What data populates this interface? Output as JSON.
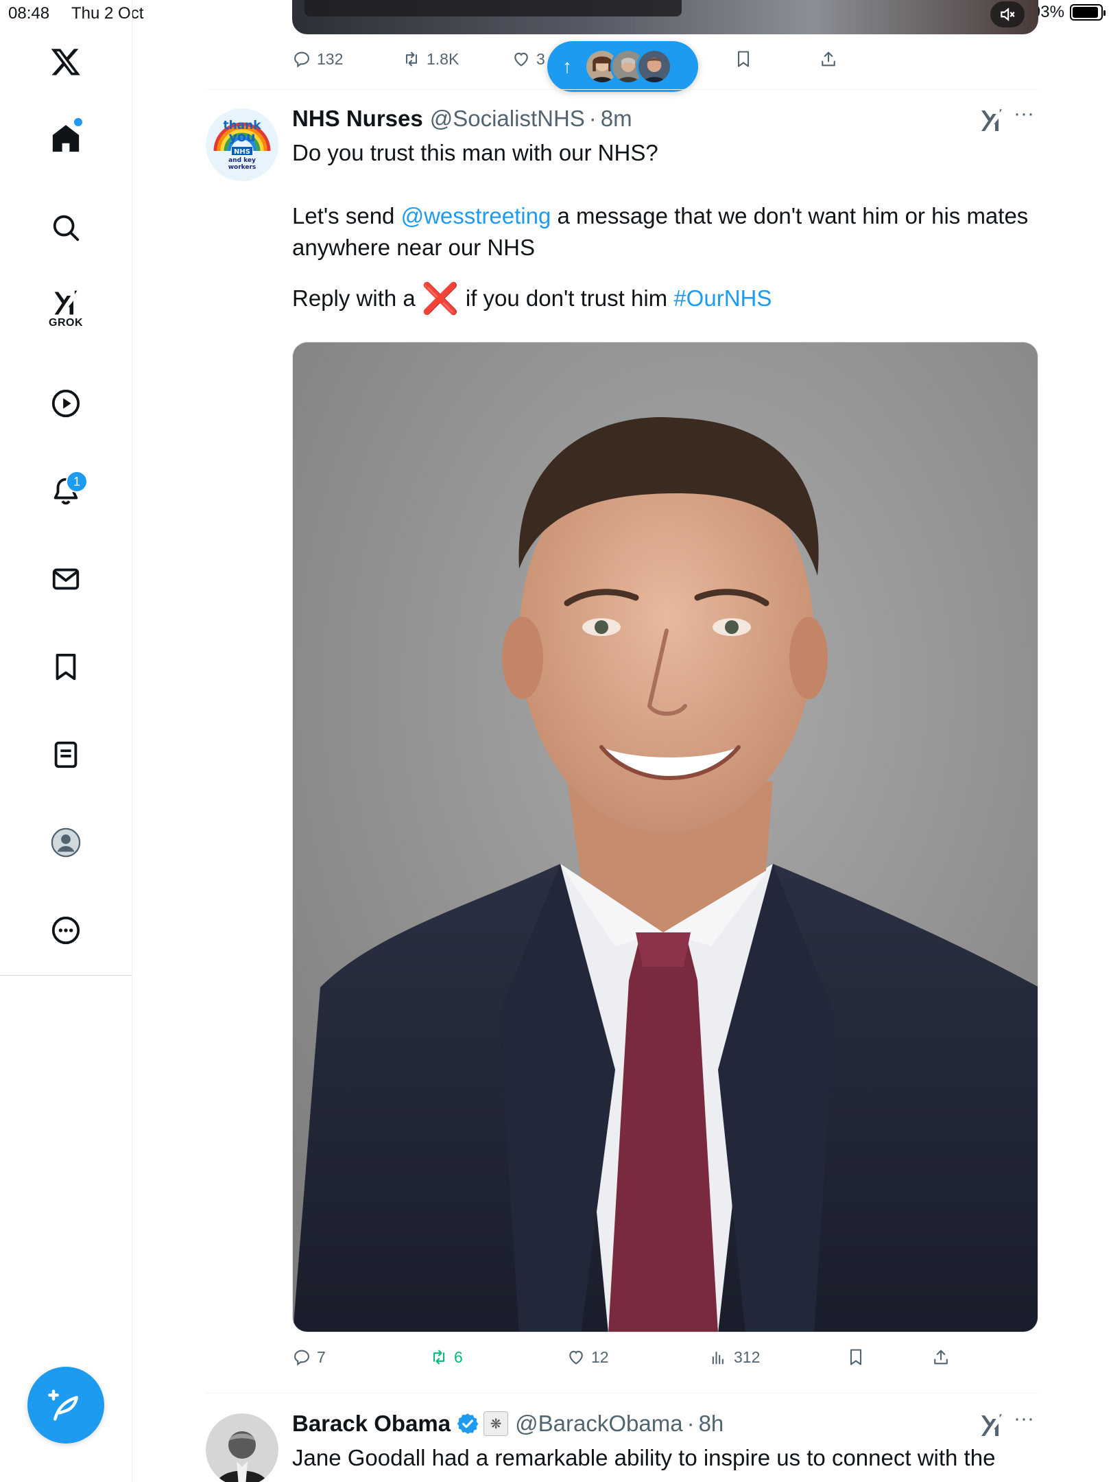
{
  "status_bar": {
    "time": "08:48",
    "date": "Thu 2 Oct",
    "battery": "93%",
    "battery_level": 0.93
  },
  "sidebar": {
    "items": [
      {
        "name": "x-logo"
      },
      {
        "name": "home",
        "has_dot": true
      },
      {
        "name": "search"
      },
      {
        "name": "grok",
        "label": "GROK"
      },
      {
        "name": "video"
      },
      {
        "name": "notifications",
        "badge": "1"
      },
      {
        "name": "messages"
      },
      {
        "name": "bookmarks"
      },
      {
        "name": "lists"
      },
      {
        "name": "profile"
      },
      {
        "name": "more"
      }
    ]
  },
  "previous_tweet": {
    "replies": "132",
    "reposts": "1.8K",
    "likes": "3"
  },
  "new_posts_pill": {
    "arrow": "↑"
  },
  "tweet": {
    "author_name": "NHS Nurses",
    "handle": "@SocialistNHS",
    "separator": "·",
    "time": "8m",
    "text_line1": "Do you trust this man with our NHS?",
    "text_p2_a": "Let's send ",
    "text_p2_mention": "@wesstreeting",
    "text_p2_b": " a message that we don't want him or his mates anywhere near our NHS",
    "text_p3_a": "Reply with a ",
    "text_p3_emoji": "❌",
    "text_p3_b": " if you don't trust him ",
    "text_p3_hashtag": "#OurNHS",
    "avatar_text": {
      "line1": "thank",
      "line2": "you",
      "line3": "NHS",
      "line4": "and key",
      "line5": "workers"
    },
    "replies": "7",
    "reposts": "6",
    "likes": "12",
    "views": "312"
  },
  "next_tweet": {
    "author_name": "Barack Obama",
    "handle": "@BarackObama",
    "separator": "·",
    "time": "8h",
    "text": "Jane Goodall had a remarkable ability to inspire us to connect with the"
  },
  "colors": {
    "accent": "#1d9bf0",
    "text": "#0f1419",
    "muted": "#536471",
    "repost_green": "#00ba7c",
    "red_x": "#e0163c"
  }
}
